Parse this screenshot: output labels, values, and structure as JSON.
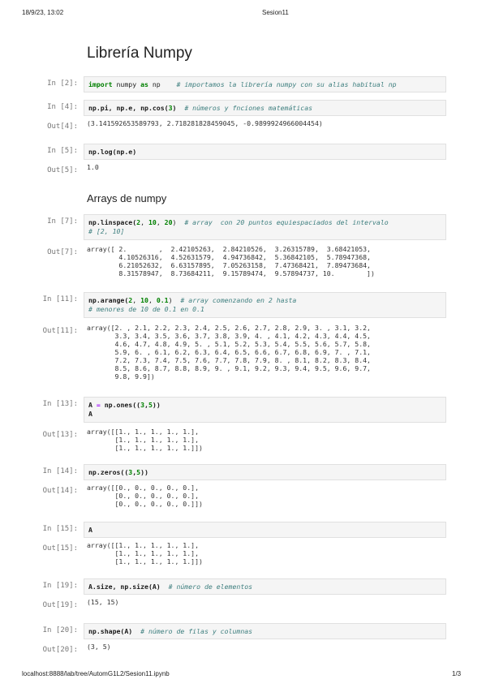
{
  "header": {
    "datetime": "18/9/23, 13:02",
    "title": "Sesion11"
  },
  "footer": {
    "url": "localhost:8888/lab/tree/AutomG1L2/Sesion11.ipynb",
    "page": "1/3"
  },
  "headings": {
    "main": "Librería Numpy",
    "arrays": "Arrays de numpy"
  },
  "cells": [
    {
      "in": "In [2]:",
      "code": [
        [
          "import",
          "kw"
        ],
        [
          " numpy ",
          ""
        ],
        [
          "as",
          "kw"
        ],
        [
          " np    ",
          ""
        ],
        [
          "# importamos la librería numpy con su alias habitual np",
          "cm"
        ]
      ]
    },
    {
      "in": "In [4]:",
      "code": [
        [
          "np.pi, np.e, np.cos(",
          "fn"
        ],
        [
          "3",
          "nm"
        ],
        [
          ")  ",
          "fn"
        ],
        [
          "# números y fnciones matemáticas",
          "cm"
        ]
      ],
      "out": "Out[4]:",
      "output": "(3.141592653589793, 2.718281828459045, -0.9899924966004454)"
    },
    {
      "in": "In [5]:",
      "code": [
        [
          "np.log(np.e)",
          "fn"
        ]
      ],
      "out": "Out[5]:",
      "output": "1.0"
    },
    {
      "in": "In [7]:",
      "code": [
        [
          "np.linspace(",
          "fn"
        ],
        [
          "2",
          "nm"
        ],
        [
          ", ",
          ""
        ],
        [
          "10",
          "nm"
        ],
        [
          ", ",
          ""
        ],
        [
          "20",
          "nm"
        ],
        [
          ")  ",
          ""
        ],
        [
          "# array  con 20 puntos equiespaciados del intervalo",
          "cm"
        ]
      ],
      "code2": "# [2, 10]",
      "out": "Out[7]:",
      "output": "array([ 2.        ,  2.42105263,  2.84210526,  3.26315789,  3.68421053,\n        4.10526316,  4.52631579,  4.94736842,  5.36842105,  5.78947368,\n        6.21052632,  6.63157895,  7.05263158,  7.47368421,  7.89473684,\n        8.31578947,  8.73684211,  9.15789474,  9.57894737, 10.        ])"
    },
    {
      "in": "In [11]:",
      "code": [
        [
          "np.arange(",
          "fn"
        ],
        [
          "2",
          "nm"
        ],
        [
          ", ",
          ""
        ],
        [
          "10",
          "nm"
        ],
        [
          ", ",
          ""
        ],
        [
          "0.1",
          "nm"
        ],
        [
          ")  ",
          ""
        ],
        [
          "# array comenzando en 2 hasta",
          "cm"
        ]
      ],
      "code2": "# menores de 10 de 0.1 en 0.1",
      "out": "Out[11]:",
      "output": "array([2. , 2.1, 2.2, 2.3, 2.4, 2.5, 2.6, 2.7, 2.8, 2.9, 3. , 3.1, 3.2,\n       3.3, 3.4, 3.5, 3.6, 3.7, 3.8, 3.9, 4. , 4.1, 4.2, 4.3, 4.4, 4.5,\n       4.6, 4.7, 4.8, 4.9, 5. , 5.1, 5.2, 5.3, 5.4, 5.5, 5.6, 5.7, 5.8,\n       5.9, 6. , 6.1, 6.2, 6.3, 6.4, 6.5, 6.6, 6.7, 6.8, 6.9, 7. , 7.1,\n       7.2, 7.3, 7.4, 7.5, 7.6, 7.7, 7.8, 7.9, 8. , 8.1, 8.2, 8.3, 8.4,\n       8.5, 8.6, 8.7, 8.8, 8.9, 9. , 9.1, 9.2, 9.3, 9.4, 9.5, 9.6, 9.7,\n       9.8, 9.9])"
    },
    {
      "in": "In [13]:",
      "code": [
        [
          "A ",
          "fn"
        ],
        [
          "=",
          "op"
        ],
        [
          " np.ones((",
          "fn"
        ],
        [
          "3",
          "nm"
        ],
        [
          ",",
          "fn"
        ],
        [
          "5",
          "nm"
        ],
        [
          "))",
          "fn"
        ]
      ],
      "code2": "A",
      "code2bold": true,
      "out": "Out[13]:",
      "output": "array([[1., 1., 1., 1., 1.],\n       [1., 1., 1., 1., 1.],\n       [1., 1., 1., 1., 1.]])"
    },
    {
      "in": "In [14]:",
      "code": [
        [
          "np.zeros((",
          "fn"
        ],
        [
          "3",
          "nm"
        ],
        [
          ",",
          "fn"
        ],
        [
          "5",
          "nm"
        ],
        [
          "))",
          "fn"
        ]
      ],
      "out": "Out[14]:",
      "output": "array([[0., 0., 0., 0., 0.],\n       [0., 0., 0., 0., 0.],\n       [0., 0., 0., 0., 0.]])"
    },
    {
      "in": "In [15]:",
      "code": [
        [
          "A",
          "fn"
        ]
      ],
      "out": "Out[15]:",
      "output": "array([[1., 1., 1., 1., 1.],\n       [1., 1., 1., 1., 1.],\n       [1., 1., 1., 1., 1.]])"
    },
    {
      "in": "In [19]:",
      "code": [
        [
          "A.size, np.size(A)  ",
          "fn"
        ],
        [
          "# número de elementos",
          "cm"
        ]
      ],
      "out": "Out[19]:",
      "output": "(15, 15)"
    },
    {
      "in": "In [20]:",
      "code": [
        [
          "np.shape(A)  ",
          "fn"
        ],
        [
          "# número de filas y columnas",
          "cm"
        ]
      ],
      "out": "Out[20]:",
      "output": "(3, 5)"
    }
  ]
}
